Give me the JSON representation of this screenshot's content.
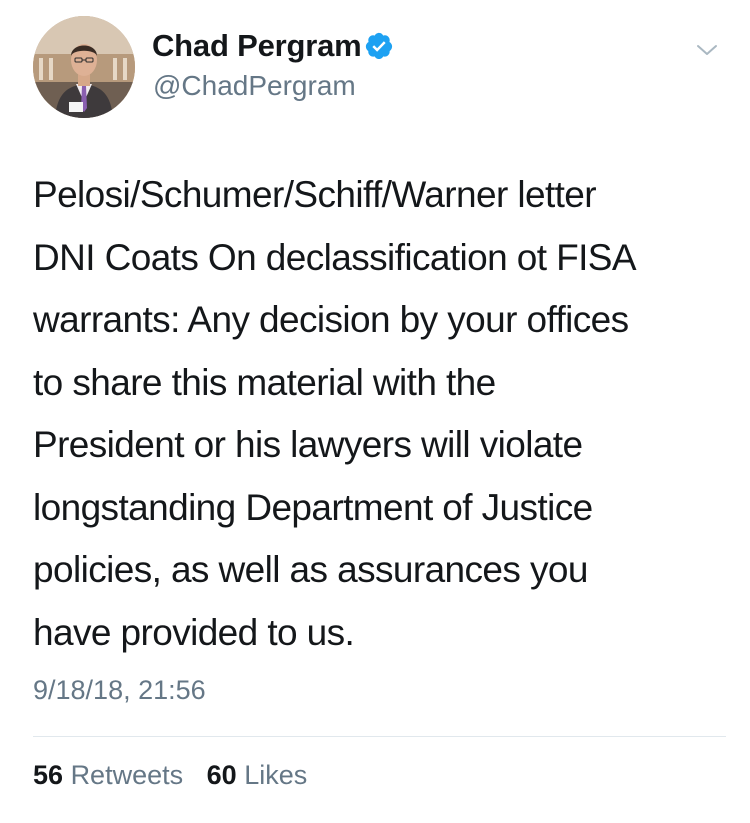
{
  "tweet": {
    "author": {
      "name": "Chad Pergram",
      "handle": "@ChadPergram",
      "verified": true
    },
    "body_lines": [
      "Pelosi/Schumer/Schiff/Warner letter",
      "DNI Coats On declassification ot FISA",
      "warrants: Any decision by your offices",
      "to share this material with the",
      "President or his lawyers will violate",
      "longstanding Department of Justice",
      "policies, as well as assurances you",
      "have provided to us."
    ],
    "timestamp": "9/18/18, 21:56",
    "stats": {
      "retweets_count": "56",
      "retweets_label": "Retweets",
      "likes_count": "60",
      "likes_label": "Likes"
    }
  },
  "icons": {
    "verified": "verified-badge-icon",
    "menu": "chevron-down-icon"
  },
  "colors": {
    "text": "#14171a",
    "secondary_text": "#657786",
    "verified_blue": "#1da1f2",
    "divider": "#e1e8ed",
    "background": "#ffffff"
  }
}
